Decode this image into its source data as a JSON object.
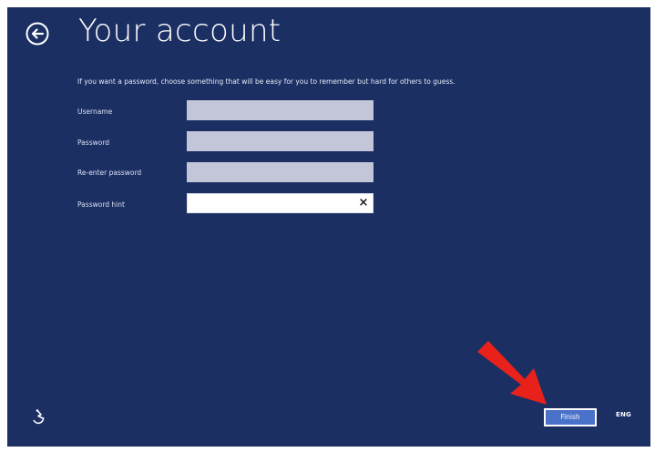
{
  "page": {
    "title": "Your account",
    "intro": "If you want a password, choose something that will be easy for you to remember but hard for others to guess."
  },
  "form": {
    "fields": [
      {
        "label": "Username",
        "value": "",
        "state": "disabled"
      },
      {
        "label": "Password",
        "value": "",
        "state": "disabled"
      },
      {
        "label": "Re-enter password",
        "value": "",
        "state": "disabled"
      },
      {
        "label": "Password hint",
        "value": "",
        "state": "active"
      }
    ],
    "clear_icon": "×"
  },
  "footer": {
    "finish_label": "Finish",
    "language": "ENG",
    "ease_of_access_icon": "ease-of-access-icon"
  },
  "colors": {
    "background": "#1b2f63",
    "finish_button": "#4a72c8",
    "disabled_field": "#c3c6d8",
    "annotation_arrow": "#e8221b"
  }
}
